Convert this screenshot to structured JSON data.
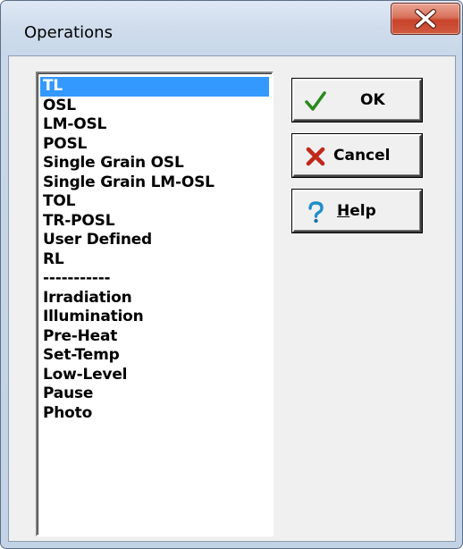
{
  "window": {
    "title": "Operations"
  },
  "list": {
    "selected": "TL",
    "items": [
      "TL",
      "OSL",
      "LM-OSL",
      "POSL",
      "Single Grain OSL",
      "Single Grain LM-OSL",
      "TOL",
      "TR-POSL",
      "User Defined",
      "RL",
      "-----------",
      "Irradiation",
      "Illumination",
      "Pre-Heat",
      "Set-Temp",
      "Low-Level",
      "Pause",
      "Photo"
    ]
  },
  "buttons": {
    "ok": {
      "label": "OK",
      "icon": "check-icon"
    },
    "cancel": {
      "label": "Cancel",
      "icon": "x-icon"
    },
    "help": {
      "mnemonic": "H",
      "rest": "elp",
      "icon": "question-icon"
    }
  },
  "colors": {
    "selection": "#3399ff",
    "check": "#2a8a1e",
    "cancel": "#c0281a",
    "help": "#1f8fc8",
    "close": "#c8432a"
  }
}
